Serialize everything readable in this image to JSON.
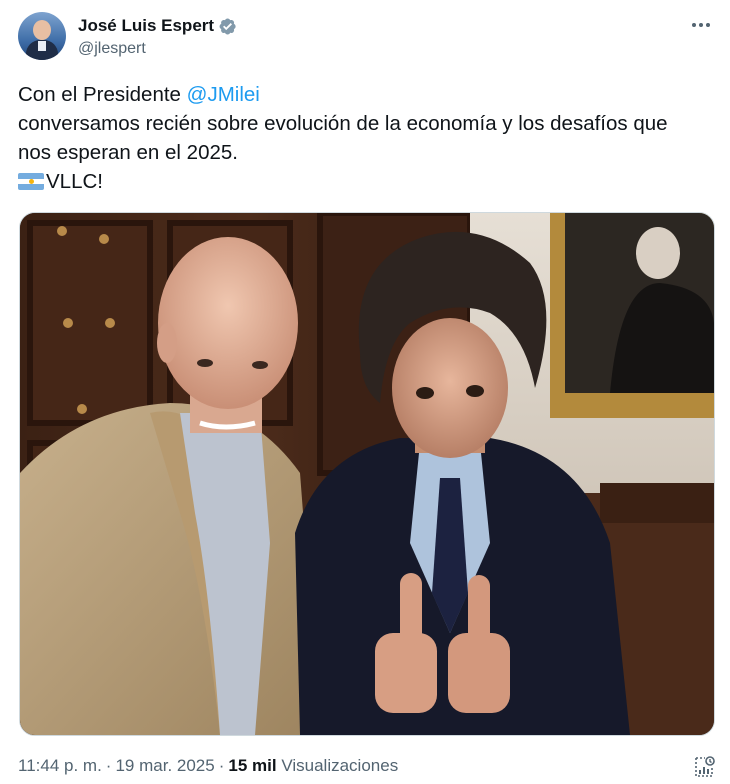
{
  "author": {
    "display_name": "José Luis Espert",
    "handle": "@jlespert",
    "avatar_icon": "avatar-photo",
    "verified_icon": "verified-badge-icon"
  },
  "tweet": {
    "line1_prefix": "Con el Presidente ",
    "mention": "@JMilei",
    "line2": "conversamos recién sobre evolución de la economía y los desafíos que",
    "line3": "nos esperan en el 2025.",
    "line4_text": "VLLC!",
    "flag_icon": "argentina-flag-icon"
  },
  "photo": {
    "description_icon": "photo"
  },
  "meta": {
    "time": "11:44 p. m.",
    "separator": "·",
    "date": "19 mar. 2025",
    "views_count": "15 mil",
    "views_label": "Visualizaciones"
  },
  "colors": {
    "text": "#0f1419",
    "secondary": "#536471",
    "link": "#1d9bf0",
    "verified": "#829aab"
  }
}
